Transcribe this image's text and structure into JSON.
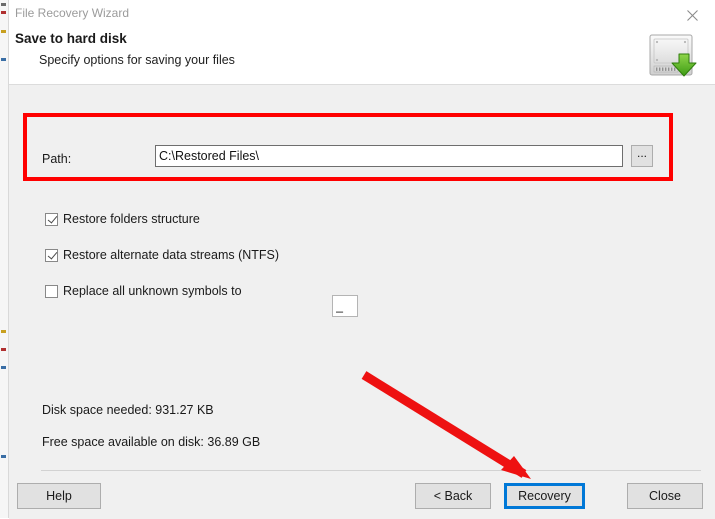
{
  "window": {
    "title": "File Recovery Wizard",
    "close_icon": "close-icon"
  },
  "header": {
    "title": "Save to hard disk",
    "subtitle": "Specify options for saving your files",
    "icon": "hard-disk-save-icon"
  },
  "form": {
    "path_label": "Path:",
    "path_value": "C:\\Restored Files\\",
    "path_placeholder": "",
    "browse_label": "...",
    "checkboxes": [
      {
        "label": "Restore folders structure",
        "checked": true
      },
      {
        "label": "Restore alternate data streams (NTFS)",
        "checked": true
      },
      {
        "label": "Replace all unknown symbols to",
        "checked": false
      }
    ],
    "symbol_value": "_"
  },
  "status": {
    "space_needed": "Disk space needed: 931.27 KB",
    "space_free": "Free space available on disk: 36.89 GB"
  },
  "footer": {
    "help_label": "Help",
    "back_label": "< Back",
    "recovery_label": "Recovery",
    "close_label": "Close"
  },
  "annotations": {
    "highlight_color": "#ff0000",
    "arrow_color": "#ee1111",
    "focus_color": "#0078d7"
  }
}
